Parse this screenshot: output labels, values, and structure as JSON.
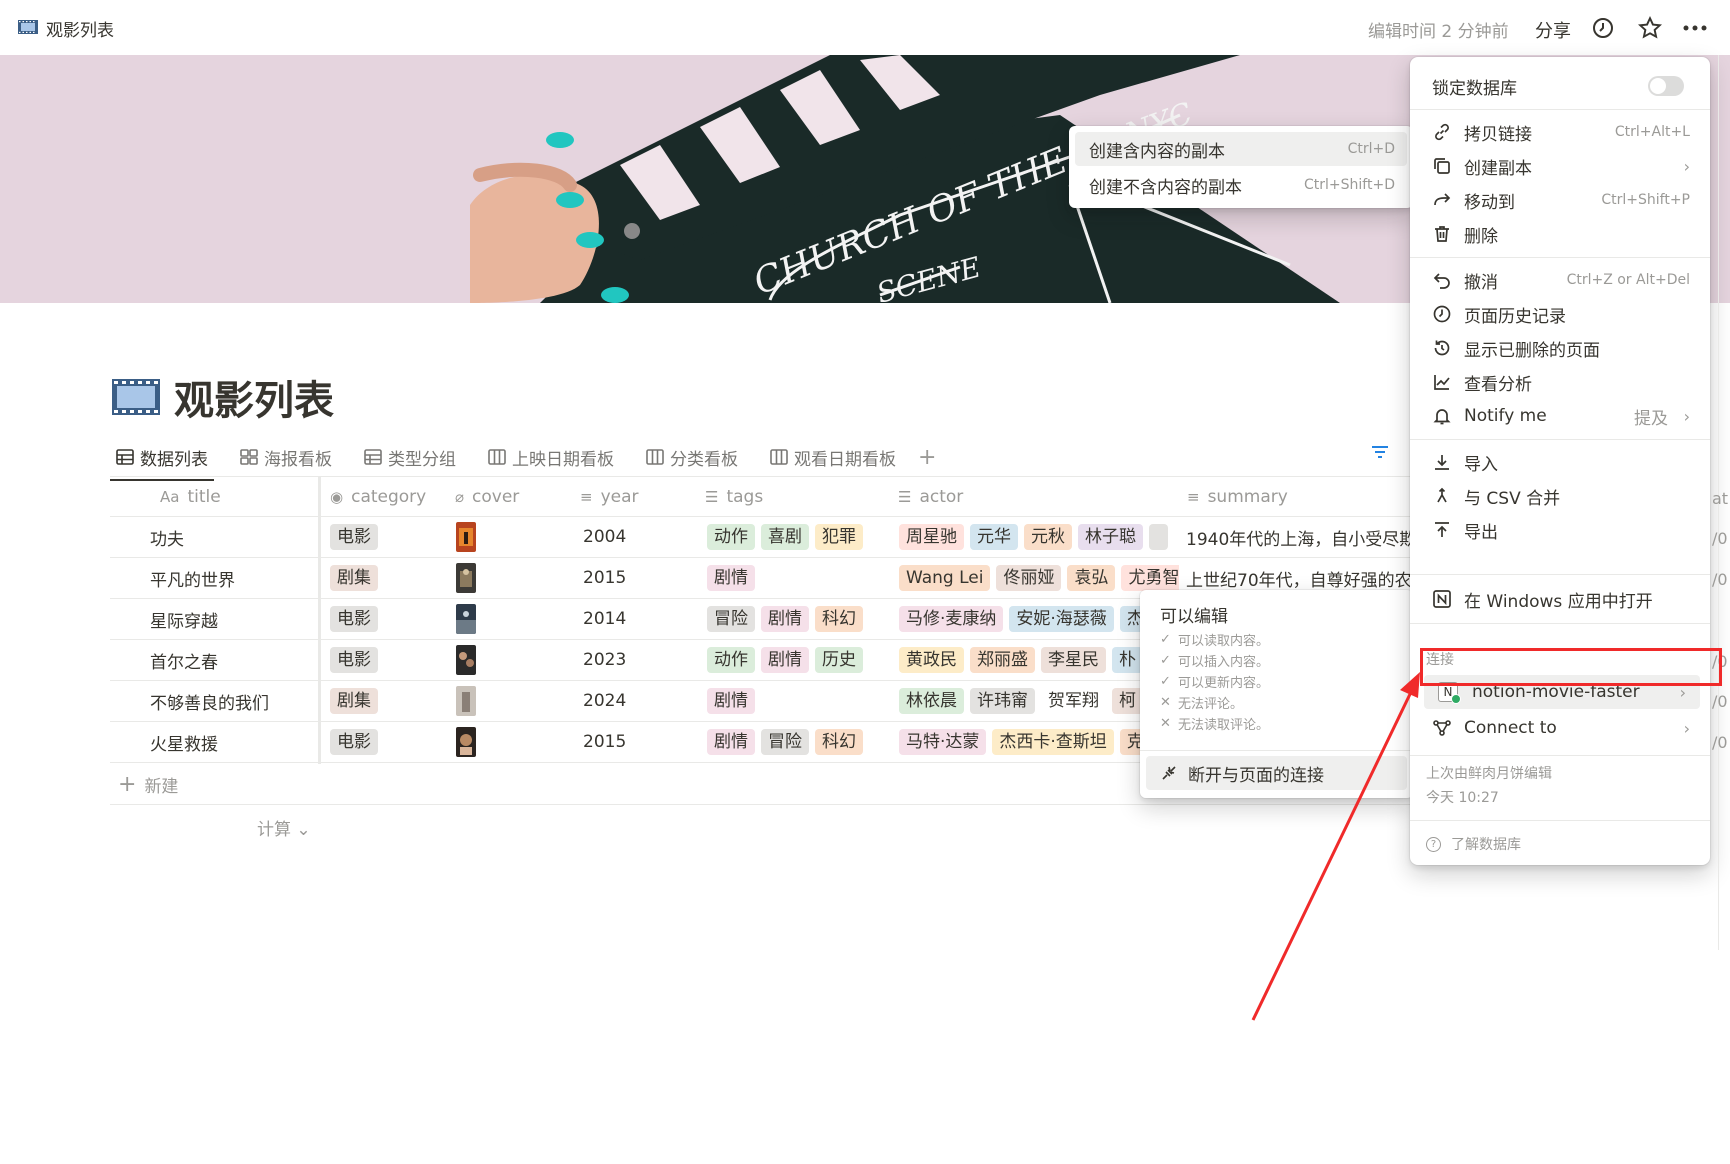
{
  "topbar": {
    "title": "观影列表",
    "edit_time": "编辑时间 2 分钟前",
    "share": "分享"
  },
  "page": {
    "title": "观影列表"
  },
  "tabs": [
    {
      "label": "数据列表",
      "icon": "table-icon"
    },
    {
      "label": "海报看板",
      "icon": "gallery-icon"
    },
    {
      "label": "类型分组",
      "icon": "table-icon"
    },
    {
      "label": "上映日期看板",
      "icon": "board-icon"
    },
    {
      "label": "分类看板",
      "icon": "board-icon"
    },
    {
      "label": "观看日期看板",
      "icon": "board-icon"
    }
  ],
  "columns": [
    {
      "label": "title",
      "icon": "Aa"
    },
    {
      "label": "category",
      "icon": "select-icon"
    },
    {
      "label": "cover",
      "icon": "attachment-icon"
    },
    {
      "label": "year",
      "icon": "text-icon"
    },
    {
      "label": "tags",
      "icon": "list-icon"
    },
    {
      "label": "actor",
      "icon": "list-icon"
    },
    {
      "label": "summary",
      "icon": "text-icon"
    }
  ],
  "rows": [
    {
      "title": "功夫",
      "category": "电影",
      "year": "2004",
      "tags": [
        "动作",
        "喜剧",
        "犯罪"
      ],
      "actors": [
        "周星驰",
        "元华",
        "元秋",
        "林子聪"
      ],
      "summary": "1940年代的上海，自小受尽欺"
    },
    {
      "title": "平凡的世界",
      "category": "剧集",
      "year": "2015",
      "tags": [
        "剧情"
      ],
      "actors": [
        "Wang Lei",
        "佟丽娅",
        "袁弘",
        "尤勇智"
      ],
      "summary": "上世纪70年代，自尊好强的农"
    },
    {
      "title": "星际穿越",
      "category": "电影",
      "year": "2014",
      "tags": [
        "冒险",
        "剧情",
        "科幻"
      ],
      "actors": [
        "马修·麦康纳",
        "安妮·海瑟薇",
        "杰西卡"
      ],
      "summary": ""
    },
    {
      "title": "首尔之春",
      "category": "电影",
      "year": "2023",
      "tags": [
        "动作",
        "剧情",
        "历史"
      ],
      "actors": [
        "黄政民",
        "郑丽盛",
        "李星民",
        "朴"
      ],
      "summary": ""
    },
    {
      "title": "不够善良的我们",
      "category": "剧集",
      "year": "2024",
      "tags": [
        "剧情"
      ],
      "actors": [
        "林依晨",
        "许玮甯",
        "贺军翔",
        "柯"
      ],
      "summary": ""
    },
    {
      "title": "火星救援",
      "category": "电影",
      "year": "2015",
      "tags": [
        "剧情",
        "冒险",
        "科幻"
      ],
      "actors": [
        "马特·达蒙",
        "杰西卡·查斯坦",
        "克"
      ],
      "summary": ""
    }
  ],
  "table_footer": {
    "new": "新建",
    "calc": "计算"
  },
  "copy_menu": {
    "items": [
      {
        "label": "创建含内容的副本",
        "shortcut": "Ctrl+D"
      },
      {
        "label": "创建不含内容的副本",
        "shortcut": "Ctrl+Shift+D"
      }
    ]
  },
  "permissions": {
    "title": "可以编辑",
    "items": [
      {
        "mark": "✓",
        "label": "可以读取内容。"
      },
      {
        "mark": "✓",
        "label": "可以插入内容。"
      },
      {
        "mark": "✓",
        "label": "可以更新内容。"
      },
      {
        "mark": "✕",
        "label": "无法评论。"
      },
      {
        "mark": "✕",
        "label": "无法读取评论。"
      }
    ],
    "disconnect": "断开与页面的连接"
  },
  "menu": {
    "lock": "锁定数据库",
    "copy_link": {
      "label": "拷贝链接",
      "shortcut": "Ctrl+Alt+L"
    },
    "duplicate": {
      "label": "创建副本"
    },
    "move_to": {
      "label": "移动到",
      "shortcut": "Ctrl+Shift+P"
    },
    "delete": {
      "label": "删除"
    },
    "undo": {
      "label": "撤消",
      "shortcut": "Ctrl+Z or Alt+Del"
    },
    "page_history": {
      "label": "页面历史记录"
    },
    "show_deleted": {
      "label": "显示已删除的页面"
    },
    "analytics": {
      "label": "查看分析"
    },
    "notify": {
      "label": "Notify me",
      "aside": "提及"
    },
    "import": {
      "label": "导入"
    },
    "merge_csv": {
      "label": "与 CSV 合并"
    },
    "export": {
      "label": "导出"
    },
    "open_windows": {
      "label": "在 Windows 应用中打开"
    },
    "connections_label": "连接",
    "connection": {
      "label": "notion-movie-faster"
    },
    "connect_to": {
      "label": "Connect to"
    },
    "last_edited": "上次由鲜肉月饼编辑",
    "last_edited_time": "今天 10:27",
    "learn": "了解数据库"
  },
  "edge": {
    "items": [
      "at",
      "/0",
      "/0",
      "/0",
      "/0",
      "/0",
      "/0"
    ]
  },
  "colors": {
    "accent_red": "#f02a2a",
    "tag_gray": "#e3e2e0",
    "tag_brown": "#eee0da",
    "tag_green": "#dbeddb",
    "tag_orange": "#fadec9",
    "tag_yellow": "#fdecc8",
    "tag_red": "#ffe2dd",
    "tag_blue": "#d3e5ef",
    "tag_purple": "#e8deee",
    "tag_pink": "#f5e0e9"
  }
}
